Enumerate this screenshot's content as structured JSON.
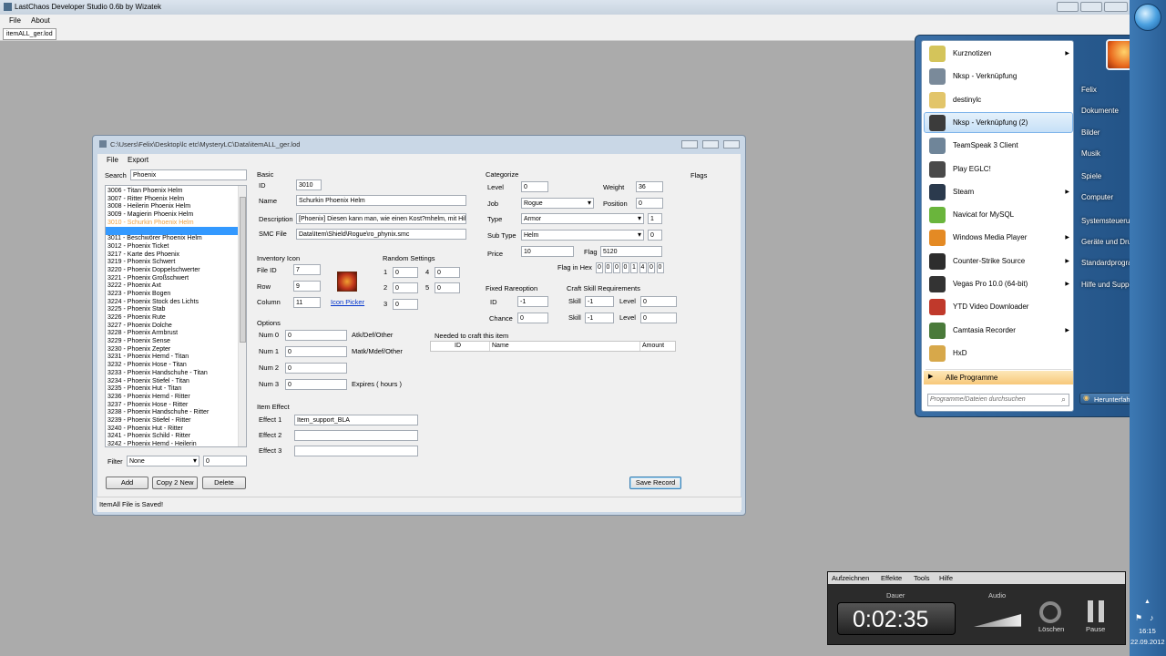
{
  "main_window": {
    "title": "LastChaos Developer Studio 0.6b by Wizatek",
    "menu": [
      "File",
      "About"
    ],
    "tab": "itemALL_ger.lod"
  },
  "child_window": {
    "path": "C:\\Users\\Felix\\Desktop\\lc etc\\MysteryLC\\Data\\itemALL_ger.lod",
    "menu": [
      "File",
      "Export"
    ],
    "search_label": "Search",
    "search_value": "Phoenix",
    "items": [
      "3006 - Titan Phoenix Helm",
      "3007 - Ritter Phoenix Helm",
      "3008 - Heilerin Phoenix Helm",
      "3009 - Magierin Phoenix Helm",
      "3010 - Schurkin Phoenix Helm",
      "",
      "3011 - Beschwörer Phoenix Helm",
      "3012 - Phoenix Ticket",
      "3217 - Karte des Phoenix",
      "3219 - Phoenix Schwert",
      "3220 - Phoenix Doppelschwerter",
      "3221 - Phoenix Großschwert",
      "3222 - Phoenix Axt",
      "3223 - Phoenix Bogen",
      "3224 - Phoenix Stock des Lichts",
      "3225 - Phoenix Stab",
      "3226 - Phoenix Rute",
      "3227 - Phoenix Dolche",
      "3228 - Phoenix Armbrust",
      "3229 - Phoenix Sense",
      "3230 - Phoenix Zepter",
      "3231 - Phoenix Hemd - Titan",
      "3232 - Phoenix Hose - Titan",
      "3233 - Phoenix Handschuhe - Titan",
      "3234 - Phoenix Stiefel - Titan",
      "3235 - Phoenix Hut - Titan",
      "3236 - Phoenix Hemd - Ritter",
      "3237 - Phoenix Hose - Ritter",
      "3238 - Phoenix Handschuhe - Ritter",
      "3239 - Phoenix Stiefel - Ritter",
      "3240 - Phoenix Hut - Ritter",
      "3241 - Phoenix Schild - Ritter",
      "3242 - Phoenix Hemd - Heilerin"
    ],
    "selected_index": 4,
    "filter_label": "Filter",
    "filter_value": "None",
    "filter_num": "0",
    "buttons": {
      "add": "Add",
      "copy": "Copy 2 New",
      "delete": "Delete",
      "save": "Save Record"
    },
    "status": "ItemAll File is Saved!",
    "basic": {
      "title": "Basic",
      "id_label": "ID",
      "id": "3010",
      "name_label": "Name",
      "name": "Schurkin Phoenix Helm",
      "desc_label": "Description",
      "desc": "[Phoenix] Diesen kann man, wie einen Kost?mhelm, mit Hil",
      "smc_label": "SMC File",
      "smc": "Data\\Item\\Shield\\Rogue\\ro_phynix.smc"
    },
    "inventory_icon": {
      "title": "Inventory Icon",
      "fileid_label": "File ID",
      "fileid": "7",
      "row_label": "Row",
      "row": "9",
      "col_label": "Column",
      "col": "11",
      "picker": "Icon Picker"
    },
    "random": {
      "title": "Random Settings",
      "labels": [
        "1",
        "2",
        "3",
        "4",
        "5"
      ],
      "values": [
        "0",
        "0",
        "0",
        "0",
        "0"
      ]
    },
    "options": {
      "title": "Options",
      "rows": [
        {
          "label": "Num 0",
          "value": "0",
          "note": "Atk/Def/Other"
        },
        {
          "label": "Num 1",
          "value": "0",
          "note": "Matk/Mdef/Other"
        },
        {
          "label": "Num 2",
          "value": "0",
          "note": ""
        },
        {
          "label": "Num 3",
          "value": "0",
          "note": "Expires ( hours )"
        }
      ]
    },
    "item_effect": {
      "title": "Item Effect",
      "rows": [
        {
          "label": "Effect 1",
          "value": "Item_support_BLA"
        },
        {
          "label": "Effect 2",
          "value": ""
        },
        {
          "label": "Effect 3",
          "value": ""
        }
      ]
    },
    "categorize": {
      "title": "Categorize",
      "level_label": "Level",
      "level": "0",
      "job_label": "Job",
      "job": "Rogue",
      "type_label": "Type",
      "type": "Armor",
      "type_num": "1",
      "subtype_label": "Sub Type",
      "subtype": "Helm",
      "subtype_num": "0",
      "price_label": "Price",
      "price": "10",
      "weight_label": "Weight",
      "weight": "36",
      "position_label": "Position",
      "position": "0",
      "flag_label": "Flag",
      "flag": "5120",
      "hex_label": "Flag in Hex",
      "hex": [
        "0",
        "0",
        "0",
        "0",
        "1",
        "4",
        "0",
        "0"
      ]
    },
    "flags_title": "Flags",
    "fixed_rareoption": {
      "title": "Fixed Rareoption",
      "id_label": "ID",
      "id": "-1",
      "chance_label": "Chance",
      "chance": "0"
    },
    "craft_skill": {
      "title": "Craft Skill Requirements",
      "skill_label": "Skill",
      "level_label": "Level",
      "rows": [
        {
          "skill": "-1",
          "level": "0"
        },
        {
          "skill": "-1",
          "level": "0"
        }
      ]
    },
    "craft_needed": {
      "title": "Needed to craft this item",
      "columns": [
        "ID",
        "Name",
        "Amount"
      ]
    }
  },
  "start_menu": {
    "left": [
      {
        "label": "Kurznotizen",
        "arrow": true,
        "color": "#d4c45a"
      },
      {
        "label": "Nksp - Verknüpfung",
        "arrow": false,
        "color": "#7a8a9a"
      },
      {
        "label": "destinylc",
        "arrow": false,
        "color": "#e2c56a"
      },
      {
        "label": "Nksp - Verknüpfung (2)",
        "arrow": false,
        "color": "#3b3b3b"
      },
      {
        "label": "TeamSpeak 3 Client",
        "arrow": false,
        "color": "#6f8599"
      },
      {
        "label": "Play EGLC!",
        "arrow": false,
        "color": "#4a4a4a"
      },
      {
        "label": "Steam",
        "arrow": true,
        "color": "#2b3a4d"
      },
      {
        "label": "Navicat for MySQL",
        "arrow": false,
        "color": "#6ab53c"
      },
      {
        "label": "Windows Media Player",
        "arrow": true,
        "color": "#e48a24"
      },
      {
        "label": "Counter-Strike Source",
        "arrow": true,
        "color": "#2d2d2d"
      },
      {
        "label": "Vegas Pro 10.0 (64-bit)",
        "arrow": true,
        "color": "#333333"
      },
      {
        "label": "YTD Video Downloader",
        "arrow": false,
        "color": "#c0392b"
      },
      {
        "label": "Camtasia Recorder",
        "arrow": true,
        "color": "#4a7a3a"
      },
      {
        "label": "HxD",
        "arrow": false,
        "color": "#d7a84a"
      }
    ],
    "all_programs": "Alle Programme",
    "search_placeholder": "Programme/Dateien durchsuchen",
    "right": [
      "Felix",
      "Dokumente",
      "Bilder",
      "Musik",
      "Spiele",
      "Computer",
      "Systemsteuerung",
      "Geräte und Drucker",
      "Standardprogramme",
      "Hilfe und Support"
    ],
    "shutdown": "Herunterfahren",
    "highlight_index": 3
  },
  "recorder": {
    "menu": [
      "Aufzeichnen",
      "Effekte",
      "Tools",
      "Hilfe"
    ],
    "duration_label": "Dauer",
    "time": "0:02:35",
    "audio_label": "Audio",
    "delete": "Löschen",
    "pause": "Pause"
  },
  "taskbar": {
    "time": "16:15",
    "date": "22.09.2012"
  }
}
